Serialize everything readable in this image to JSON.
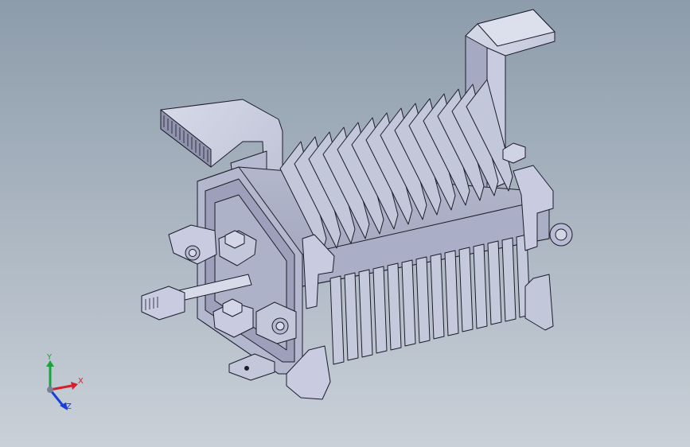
{
  "viewport": {
    "background_top": "#8d9cab",
    "background_bottom": "#c9d0d8"
  },
  "model": {
    "part_fill": "#c8ccdd",
    "part_shade": "#9ea3bd",
    "edge_color": "#1c1d2a"
  },
  "triad": {
    "x_label": "X",
    "y_label": "Y",
    "z_label": "Z",
    "x_color": "#d4202a",
    "y_color": "#18a33c",
    "z_color": "#1a3fd8"
  }
}
